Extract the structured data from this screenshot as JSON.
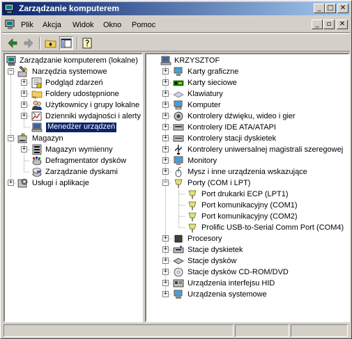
{
  "window": {
    "title": "Zarządzanie komputerem"
  },
  "caption_buttons": [
    "_",
    "□",
    "✕"
  ],
  "menubar": {
    "items": [
      "Plik",
      "Akcja",
      "Widok",
      "Okno",
      "Pomoc"
    ],
    "mdi_buttons": [
      "_",
      "▫",
      "✕"
    ]
  },
  "toolbar": {
    "buttons": [
      "back-icon",
      "forward-icon",
      "up-folder-icon",
      "show-hide-tree-icon",
      "help-icon"
    ]
  },
  "left_tree": {
    "root": "Zarządzanie komputerem (lokalne)",
    "items": [
      {
        "label": "Narzędzia systemowe",
        "icon": "tools-icon"
      },
      {
        "label": "Podgląd zdarzeń",
        "icon": "event-viewer-icon"
      },
      {
        "label": "Foldery udostępnione",
        "icon": "shared-folder-icon"
      },
      {
        "label": "Użytkownicy i grupy lokalne",
        "icon": "users-icon"
      },
      {
        "label": "Dzienniki wydajności i alerty",
        "icon": "perf-logs-icon"
      },
      {
        "label": "Menedżer urządzeń",
        "icon": "device-manager-icon"
      },
      {
        "label": "Magazyn",
        "icon": "storage-icon"
      },
      {
        "label": "Magazyn wymienny",
        "icon": "removable-storage-icon"
      },
      {
        "label": "Defragmentator dysków",
        "icon": "defrag-icon"
      },
      {
        "label": "Zarządzanie dyskami",
        "icon": "disk-management-icon"
      },
      {
        "label": "Usługi i aplikacje",
        "icon": "services-icon"
      }
    ]
  },
  "right_tree": {
    "root": "KRZYSZTOF",
    "items": [
      {
        "label": "Karty graficzne",
        "icon": "display-adapter-icon"
      },
      {
        "label": "Karty sieciowe",
        "icon": "network-adapter-icon"
      },
      {
        "label": "Klawiatury",
        "icon": "keyboard-icon"
      },
      {
        "label": "Komputer",
        "icon": "computer-icon"
      },
      {
        "label": "Kontrolery dźwięku, wideo i gier",
        "icon": "sound-icon"
      },
      {
        "label": "Kontrolery IDE ATA/ATAPI",
        "icon": "ide-icon"
      },
      {
        "label": "Kontrolery stacji dyskietek",
        "icon": "floppy-controller-icon"
      },
      {
        "label": "Kontrolery uniwersalnej magistrali szeregowej",
        "icon": "usb-icon"
      },
      {
        "label": "Monitory",
        "icon": "monitor-icon"
      },
      {
        "label": "Mysz i inne urządzenia wskazujące",
        "icon": "mouse-icon"
      },
      {
        "label": "Porty (COM i LPT)",
        "icon": "port-icon"
      },
      {
        "label": "Port drukarki ECP (LPT1)",
        "icon": "port-icon"
      },
      {
        "label": "Port komunikacyjny (COM1)",
        "icon": "port-icon"
      },
      {
        "label": "Port komunikacyjny (COM2)",
        "icon": "port-icon"
      },
      {
        "label": "Prolific USB-to-Serial Comm Port (COM4)",
        "icon": "port-icon"
      },
      {
        "label": "Procesory",
        "icon": "processor-icon"
      },
      {
        "label": "Stacje dyskietek",
        "icon": "floppy-drive-icon"
      },
      {
        "label": "Stacje dysków",
        "icon": "disk-drive-icon"
      },
      {
        "label": "Stacje dysków CD-ROM/DVD",
        "icon": "cdrom-icon"
      },
      {
        "label": "Urządzenia interfejsu HID",
        "icon": "hid-icon"
      },
      {
        "label": "Urządzenia systemowe",
        "icon": "system-devices-icon"
      }
    ]
  },
  "colors": {
    "title_gradient_start": "#0a246a",
    "title_gradient_end": "#a6caf0",
    "selection": "#0a246a",
    "face": "#d4d0c8"
  }
}
